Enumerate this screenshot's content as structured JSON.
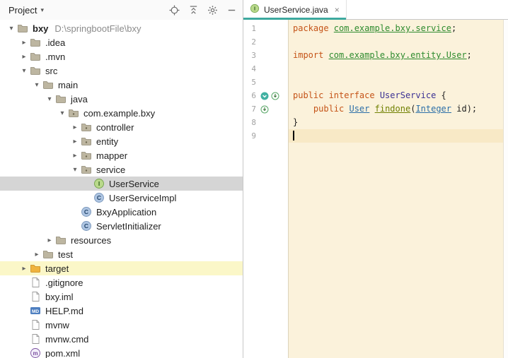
{
  "colors": {
    "tab-accent": "#3da99f",
    "editor-bg": "#fbf2db",
    "current-line-bg": "#f8e9c6",
    "selection-bg": "#d5d5d5",
    "target-row-bg": "#fbf7c8",
    "keyword": "#c55418",
    "package-ref": "#2e8b2e",
    "type-decl": "#3b3193",
    "type-ref": "#2c6fa8",
    "method-name": "#708000",
    "plain-code": "#1f1f1f",
    "line-number": "#a1a1a1"
  },
  "project_panel": {
    "header": {
      "title": "Project",
      "dropdown_icon": "chevron-down",
      "icons": [
        "locate",
        "collapse-all",
        "settings",
        "hide"
      ]
    },
    "tree": [
      {
        "label": "bxy",
        "suffix": "D:\\springbootFile\\bxy",
        "level": 0,
        "arrow": "down",
        "icon": "folder",
        "bold": true
      },
      {
        "label": ".idea",
        "level": 1,
        "arrow": "right",
        "icon": "folder"
      },
      {
        "label": ".mvn",
        "level": 1,
        "arrow": "right",
        "icon": "folder"
      },
      {
        "label": "src",
        "level": 1,
        "arrow": "down",
        "icon": "folder"
      },
      {
        "label": "main",
        "level": 2,
        "arrow": "down",
        "icon": "folder"
      },
      {
        "label": "java",
        "level": 3,
        "arrow": "down",
        "icon": "folder"
      },
      {
        "label": "com.example.bxy",
        "level": 4,
        "arrow": "down",
        "icon": "package"
      },
      {
        "label": "controller",
        "level": 5,
        "arrow": "right",
        "icon": "package"
      },
      {
        "label": "entity",
        "level": 5,
        "arrow": "right",
        "icon": "package"
      },
      {
        "label": "mapper",
        "level": 5,
        "arrow": "right",
        "icon": "package"
      },
      {
        "label": "service",
        "level": 5,
        "arrow": "down",
        "icon": "package"
      },
      {
        "label": "UserService",
        "level": 6,
        "arrow": "none",
        "icon": "interface",
        "selected": true
      },
      {
        "label": "UserServiceImpl",
        "level": 6,
        "arrow": "none",
        "icon": "class"
      },
      {
        "label": "BxyApplication",
        "level": 5,
        "arrow": "none",
        "icon": "class"
      },
      {
        "label": "ServletInitializer",
        "level": 5,
        "arrow": "none",
        "icon": "class"
      },
      {
        "label": "resources",
        "level": 3,
        "arrow": "right",
        "icon": "folder"
      },
      {
        "label": "test",
        "level": 2,
        "arrow": "right",
        "icon": "folder"
      },
      {
        "label": "target",
        "level": 1,
        "arrow": "right",
        "icon": "folder-excluded",
        "row_highlight": true
      },
      {
        "label": ".gitignore",
        "level": 1,
        "arrow": "none",
        "icon": "file"
      },
      {
        "label": "bxy.iml",
        "level": 1,
        "arrow": "none",
        "icon": "file"
      },
      {
        "label": "HELP.md",
        "level": 1,
        "arrow": "none",
        "icon": "file-md"
      },
      {
        "label": "mvnw",
        "level": 1,
        "arrow": "none",
        "icon": "file"
      },
      {
        "label": "mvnw.cmd",
        "level": 1,
        "arrow": "none",
        "icon": "file"
      },
      {
        "label": "pom.xml",
        "level": 1,
        "arrow": "none",
        "icon": "file-maven"
      }
    ]
  },
  "editor": {
    "tab": {
      "title": "UserService.java",
      "icon": "interface",
      "close_glyph": "×"
    },
    "lines": [
      {
        "num": 1,
        "tokens": [
          {
            "t": "package ",
            "c": "kw"
          },
          {
            "t": "com.example.bxy.service",
            "c": "pkg"
          },
          {
            "t": ";",
            "c": "plain"
          }
        ]
      },
      {
        "num": 2,
        "tokens": []
      },
      {
        "num": 3,
        "tokens": [
          {
            "t": "import ",
            "c": "kw"
          },
          {
            "t": "com.example.bxy.entity.User",
            "c": "pkg"
          },
          {
            "t": ";",
            "c": "plain"
          }
        ]
      },
      {
        "num": 4,
        "tokens": []
      },
      {
        "num": 5,
        "tokens": []
      },
      {
        "num": 6,
        "gutter": [
          "implemented-marker",
          "override-marker"
        ],
        "tokens": [
          {
            "t": "public interface ",
            "c": "kw"
          },
          {
            "t": "UserService ",
            "c": "type"
          },
          {
            "t": "{",
            "c": "plain"
          }
        ]
      },
      {
        "num": 7,
        "gutter": [
          "override-marker"
        ],
        "tokens": [
          {
            "t": "    ",
            "c": "plain"
          },
          {
            "t": "public ",
            "c": "kw"
          },
          {
            "t": "User",
            "c": "typeref"
          },
          {
            "t": " ",
            "c": "plain"
          },
          {
            "t": "findone",
            "c": "method"
          },
          {
            "t": "(",
            "c": "plain"
          },
          {
            "t": "Integer",
            "c": "typeref"
          },
          {
            "t": " id)",
            "c": "plain"
          },
          {
            "t": ";",
            "c": "plain"
          }
        ]
      },
      {
        "num": 8,
        "tokens": [
          {
            "t": "}",
            "c": "plain"
          }
        ]
      },
      {
        "num": 9,
        "current": true,
        "tokens": []
      }
    ]
  }
}
